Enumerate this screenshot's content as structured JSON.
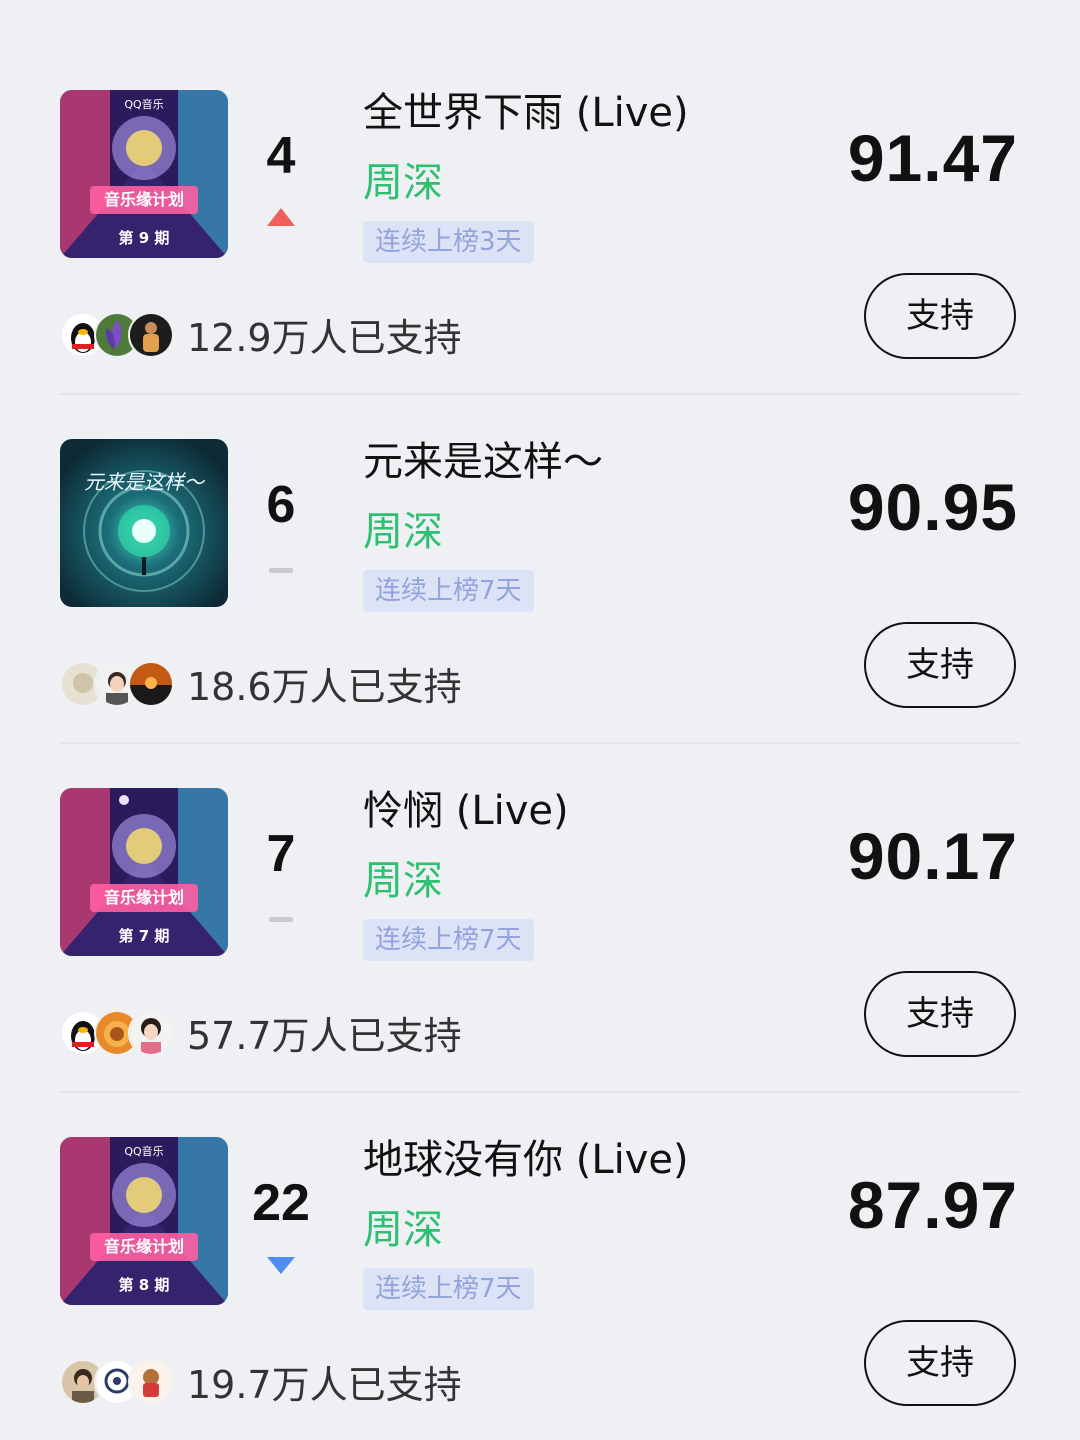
{
  "entries": [
    {
      "rank": "4",
      "trend": "up",
      "title": "全世界下雨 (Live)",
      "artist": "周深",
      "streak": "连续上榜3天",
      "score": "91.47",
      "supporters": "12.9万人已支持",
      "support_label": "支持",
      "cover": {
        "variant": "festival",
        "brand": "QQ音乐",
        "show_title": "音乐缘计划",
        "episode": "第 9 期"
      }
    },
    {
      "rank": "6",
      "trend": "flat",
      "title": "元来是这样～",
      "artist": "周深",
      "streak": "连续上榜7天",
      "score": "90.95",
      "supporters": "18.6万人已支持",
      "support_label": "支持",
      "cover": {
        "variant": "tunnel",
        "show_title": "元来是这样～"
      }
    },
    {
      "rank": "7",
      "trend": "flat",
      "title": "怜悯 (Live)",
      "artist": "周深",
      "streak": "连续上榜7天",
      "score": "90.17",
      "supporters": "57.7万人已支持",
      "support_label": "支持",
      "cover": {
        "variant": "festival",
        "brand": "",
        "show_title": "音乐缘计划",
        "episode": "第 7 期"
      }
    },
    {
      "rank": "22",
      "trend": "down",
      "title": "地球没有你 (Live)",
      "artist": "周深",
      "streak": "连续上榜7天",
      "score": "87.97",
      "supporters": "19.7万人已支持",
      "support_label": "支持",
      "cover": {
        "variant": "festival",
        "brand": "QQ音乐",
        "show_title": "音乐缘计划",
        "episode": "第 8 期"
      }
    }
  ],
  "colors": {
    "background": "#eff0f4",
    "artist": "#2fbf71",
    "trend_up": "#f0605a",
    "trend_down": "#4f8ef0",
    "trend_flat": "#c9cacf",
    "streak_bg": "#dde3f6",
    "streak_text": "#93a3dc"
  },
  "icons": {
    "trend_up": "triangle-up-icon",
    "trend_down": "triangle-down-icon",
    "trend_flat": "dash-icon"
  }
}
